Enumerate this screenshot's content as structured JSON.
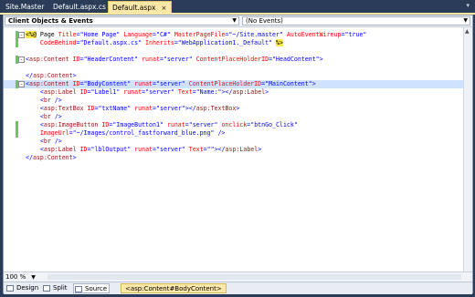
{
  "tabs": [
    {
      "label": "Site.Master",
      "active": false
    },
    {
      "label": "Default.aspx.cs",
      "active": false
    },
    {
      "label": "Default.aspx",
      "active": true
    }
  ],
  "close_glyph": "×",
  "dropdowns": {
    "left": "Client Objects & Events",
    "right": "(No Events)"
  },
  "code_lines": [
    "<%@ Page Title=\"Home Page\" Language=\"C#\" MasterPageFile=\"~/Site.master\" AutoEventWireup=\"true\"",
    "    CodeBehind=\"Default.aspx.cs\" Inherits=\"WebApplication1._Default\" %>",
    "",
    "<asp:Content ID=\"HeaderContent\" runat=\"server\" ContentPlaceHolderID=\"HeadContent\">",
    "",
    "</asp:Content>",
    "<asp:Content ID=\"BodyContent\" runat=\"server\" ContentPlaceHolderID=\"MainContent\">",
    "    <asp:Label ID=\"Label1\" runat=\"server\" Text=\"Name:\"></asp:Label>",
    "    <br />",
    "    <asp:TextBox ID=\"txtName\" runat=\"server\"></asp:TextBox>",
    "    <br />",
    "    <asp:ImageButton ID=\"ImageButton1\" runat=\"server\" onclick=\"btnGo_Click\"",
    "    ImageUrl=\"~/Images/control_fastforward_blue.png\" />",
    "    <br />",
    "    <asp:Label ID=\"lblOutput\" runat=\"server\" Text=\"\"></asp:Label>",
    "</asp:Content>"
  ],
  "zoom": "100 %",
  "view_buttons": [
    {
      "label": "Design",
      "active": false
    },
    {
      "label": "Split",
      "active": false
    },
    {
      "label": "Source",
      "active": true
    }
  ],
  "breadcrumb": "<asp:Content#BodyContent>",
  "colors": {
    "chrome": "#2b3c59",
    "active_tab": "#fde8a8",
    "change_marker": "#6fc45c"
  }
}
